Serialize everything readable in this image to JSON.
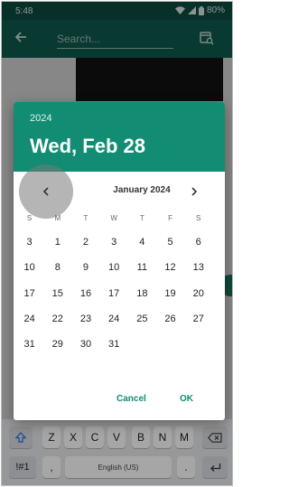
{
  "status_bar": {
    "time": "5:48",
    "battery": "80%",
    "icons": [
      "wifi-icon",
      "signal-icon",
      "battery-icon"
    ]
  },
  "toolbar": {
    "back_icon": "arrow-left-icon",
    "search_placeholder": "Search...",
    "action_icon": "calendar-search-icon"
  },
  "date_picker": {
    "year": "2024",
    "selected_date": "Wed, Feb 28",
    "month_label": "January 2024",
    "prev_icon": "chevron-left-icon",
    "next_icon": "chevron-right-icon",
    "weekdays": [
      "S",
      "M",
      "T",
      "W",
      "T",
      "F",
      "S"
    ],
    "weeks": [
      [
        "3",
        "1",
        "2",
        "3",
        "4",
        "5",
        "6"
      ],
      [
        "10",
        "8",
        "9",
        "10",
        "11",
        "12",
        "13"
      ],
      [
        "17",
        "15",
        "16",
        "17",
        "18",
        "19",
        "20"
      ],
      [
        "24",
        "22",
        "23",
        "24",
        "25",
        "26",
        "27"
      ],
      [
        "31",
        "29",
        "30",
        "31",
        "",
        "",
        ""
      ]
    ],
    "cancel_label": "Cancel",
    "ok_label": "OK",
    "accent_color": "#128c73"
  },
  "keyboard": {
    "row1": [
      "Z",
      "X",
      "C",
      "V",
      "B",
      "N",
      "M"
    ],
    "symbols_key": "!#1",
    "comma_key": ",",
    "space_label": "English (US)",
    "period_key": ".",
    "shift_icon": "shift-icon",
    "backspace_icon": "backspace-icon",
    "enter_icon": "enter-icon"
  }
}
